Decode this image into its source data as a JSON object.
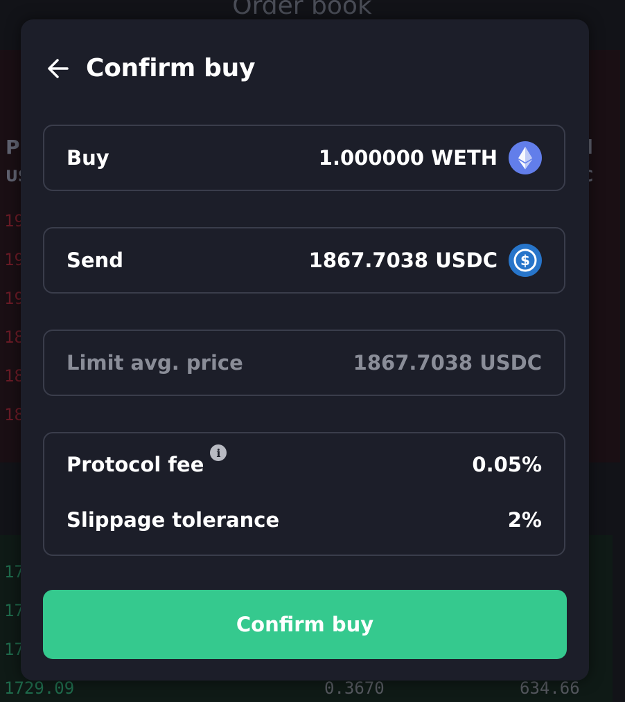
{
  "background": {
    "title": "Order book",
    "col_header_left_1": "P",
    "col_header_left_2": "US",
    "col_header_right_1": "l",
    "col_header_right_2": "C",
    "red_rows": [
      "19",
      "19",
      "19",
      "18",
      "18",
      "18"
    ],
    "green_rows": [
      "17",
      "17",
      "17"
    ],
    "bottom_row": {
      "price": "1729.09",
      "amount": "0.3670",
      "total": "634.66"
    }
  },
  "modal": {
    "title": "Confirm buy",
    "buy": {
      "label": "Buy",
      "value": "1.000000 WETH",
      "icon": "eth-icon"
    },
    "send": {
      "label": "Send",
      "value": "1867.7038 USDC",
      "icon": "usdc-icon"
    },
    "limit": {
      "label": "Limit avg. price",
      "value": "1867.7038 USDC"
    },
    "fees": {
      "protocol_fee_label": "Protocol fee",
      "protocol_fee_value": "0.05%",
      "slippage_label": "Slippage tolerance",
      "slippage_value": "2%"
    },
    "confirm_button": "Confirm buy"
  },
  "colors": {
    "accent_green": "#35c98e",
    "modal_bg": "#1c1e29",
    "eth_blue": "#627eea",
    "usdc_blue": "#2775ca"
  }
}
